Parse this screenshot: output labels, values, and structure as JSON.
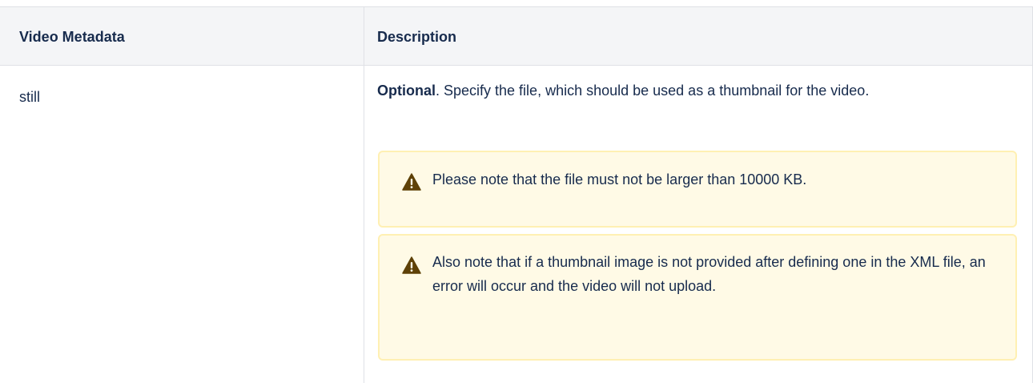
{
  "table": {
    "headers": [
      "Video Metadata",
      "Description"
    ],
    "row": {
      "key": "still",
      "description_bold": "Optional",
      "description_rest": ". Specify the file, which should be used as a thumbnail for the video."
    },
    "notes": [
      {
        "icon": "warning-icon",
        "text": "Please note that the file must not be larger than 10000 KB."
      },
      {
        "icon": "warning-icon",
        "text": "Also note that if a thumbnail image is not provided after defining one in the XML file, an error will occur and the video will not upload."
      }
    ]
  },
  "colors": {
    "header_bg": "#f4f5f7",
    "note_bg": "#fffae6",
    "note_border": "#fff0b3",
    "warning_icon": "#5e4107",
    "text": "#172b4d"
  }
}
